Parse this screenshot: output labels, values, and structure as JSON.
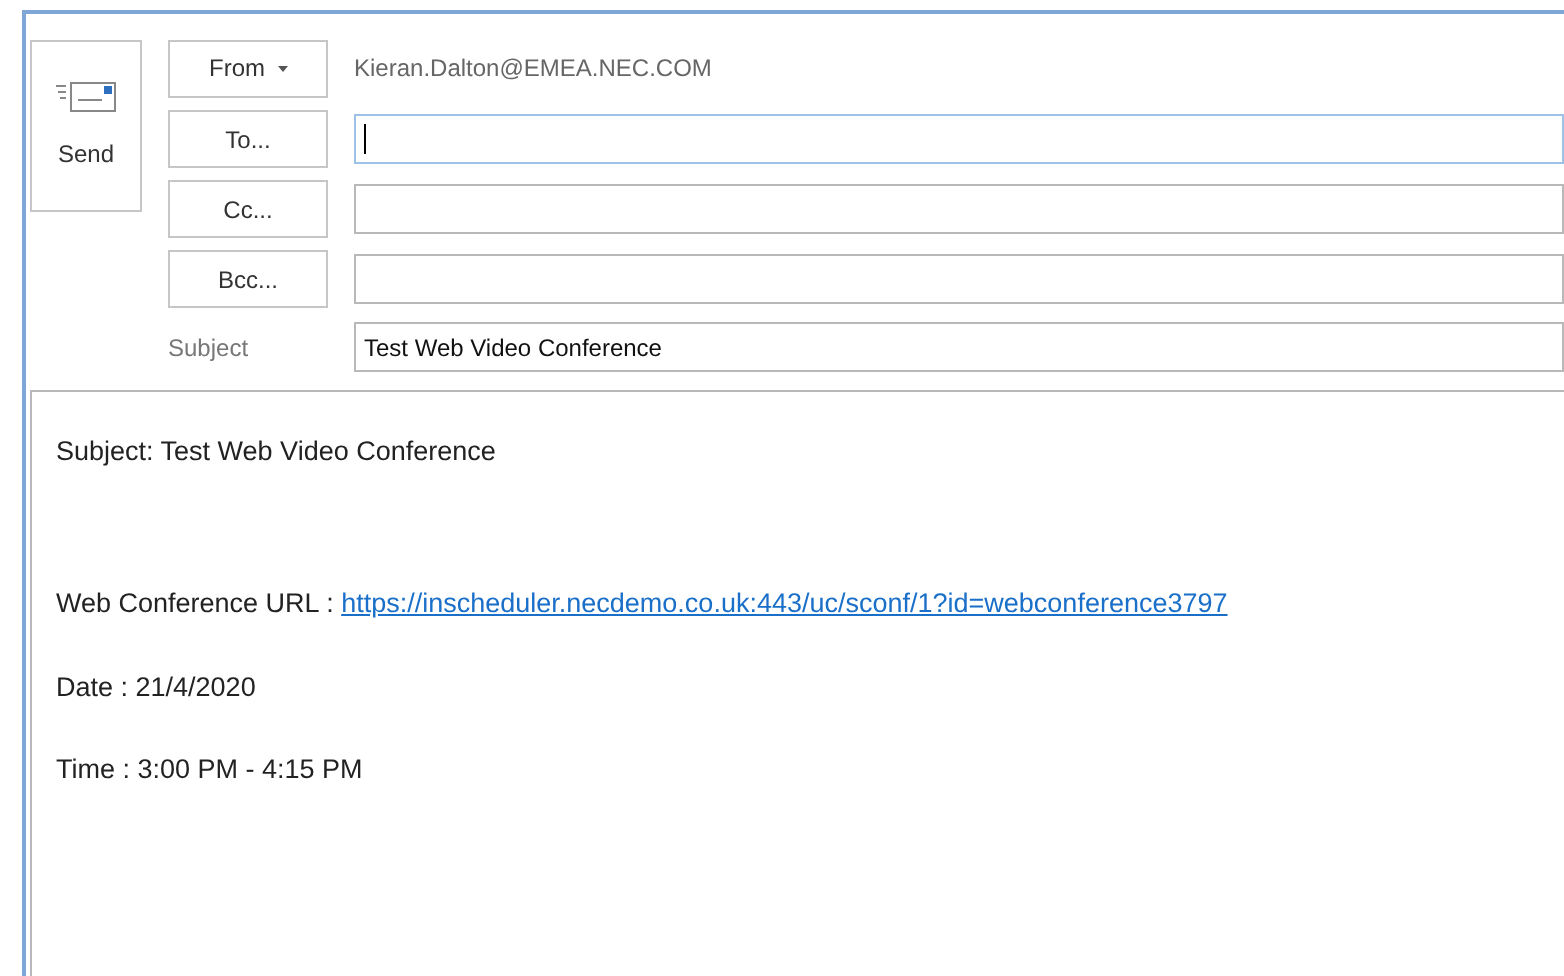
{
  "send_button": {
    "label": "Send"
  },
  "from": {
    "label": "From",
    "value": "Kieran.Dalton@EMEA.NEC.COM"
  },
  "recipients": [
    {
      "label": "To...",
      "focused": true
    },
    {
      "label": "Cc...",
      "focused": false
    },
    {
      "label": "Bcc...",
      "focused": false
    }
  ],
  "subject": {
    "label": "Subject",
    "value": "Test Web Video Conference"
  },
  "body": [
    {
      "text": "Subject: Test Web Video Conference"
    },
    {
      "text": "Web Conference URL : ",
      "link": "https://inscheduler.necdemo.co.uk:443/uc/sconf/1?id=webconference3797"
    },
    {
      "text": "Date : 21/4/2020"
    },
    {
      "text": "Time : 3:00 PM - 4:15 PM"
    }
  ]
}
